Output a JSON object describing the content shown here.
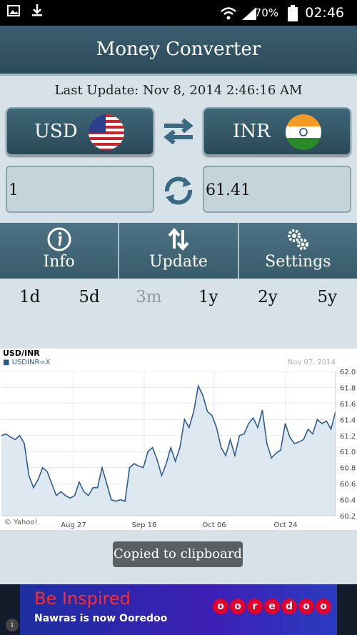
{
  "status_bar": {
    "battery_percent": "70%",
    "time": "02:46"
  },
  "app": {
    "title": "Money Converter",
    "last_update": "Last Update: Nov 8, 2014 2:46:16 AM"
  },
  "converter": {
    "from_currency": "USD",
    "to_currency": "INR",
    "from_value": "1",
    "to_value": "61.41"
  },
  "toolbar": {
    "items": [
      {
        "label": "Info",
        "icon": "info-icon"
      },
      {
        "label": "Update",
        "icon": "update-arrows-icon"
      },
      {
        "label": "Settings",
        "icon": "gears-icon"
      }
    ]
  },
  "ranges": {
    "items": [
      "1d",
      "5d",
      "3m",
      "1y",
      "2y",
      "5y"
    ],
    "active": "3m"
  },
  "chart_data": {
    "type": "line",
    "title": "USD/INR",
    "legend": "USDINR=X",
    "date": "Nov 07, 2014",
    "credit": "© Yahoo!",
    "x_ticks": [
      "Aug 27",
      "Sep 16",
      "Oct 06",
      "Oct 24"
    ],
    "ylim": [
      60.2,
      62.0
    ],
    "y_ticks": [
      "62.0",
      "61.8",
      "61.6",
      "61.4",
      "61.2",
      "61.0",
      "60.8",
      "60.6",
      "60.4",
      "60.2"
    ],
    "grid": true,
    "series": [
      {
        "name": "USDINR=X",
        "values": [
          61.2,
          61.22,
          61.18,
          61.15,
          61.2,
          61.1,
          60.7,
          60.55,
          60.65,
          60.8,
          60.75,
          60.6,
          60.45,
          60.5,
          60.45,
          60.42,
          60.45,
          60.62,
          60.5,
          60.45,
          60.55,
          60.55,
          60.8,
          60.6,
          60.4,
          60.38,
          60.4,
          60.38,
          60.8,
          60.85,
          60.82,
          60.8,
          61.0,
          61.05,
          60.9,
          60.7,
          60.85,
          61.05,
          60.88,
          61.05,
          61.4,
          61.3,
          61.5,
          61.82,
          61.7,
          61.5,
          61.45,
          61.3,
          61.05,
          60.95,
          61.15,
          60.95,
          61.2,
          61.22,
          61.35,
          61.42,
          61.3,
          61.52,
          61.1,
          60.92,
          60.98,
          61.02,
          61.35,
          61.18,
          61.1,
          61.12,
          61.15,
          61.28,
          61.22,
          61.4,
          61.35,
          61.38,
          61.28,
          61.5
        ]
      }
    ]
  },
  "toast": "Copied to clipboard",
  "ad": {
    "headline": "Be Inspired",
    "subline": "Nawras is now Ooredoo",
    "brand": "ooredoo"
  }
}
